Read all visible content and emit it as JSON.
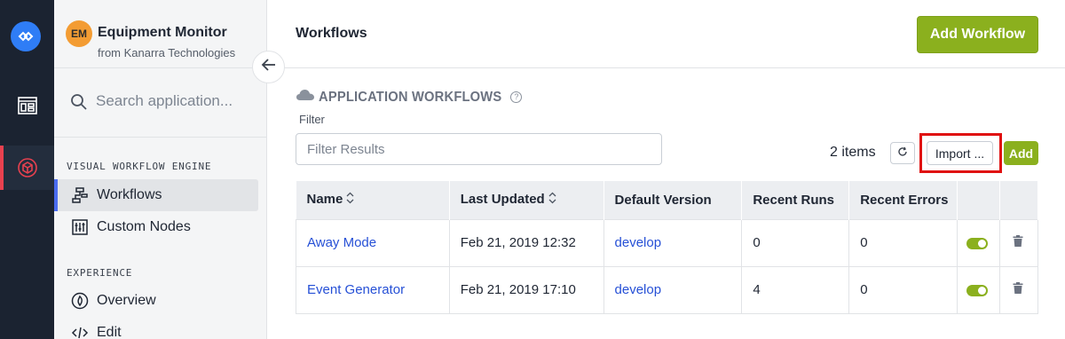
{
  "app": {
    "avatar_initials": "EM",
    "name": "Equipment Monitor",
    "org": "from Kanarra Technologies",
    "avatar_color": "#f39c33"
  },
  "search": {
    "placeholder": "Search application..."
  },
  "sidebar": {
    "sections": [
      {
        "label": "VISUAL WORKFLOW ENGINE"
      },
      {
        "label": "EXPERIENCE"
      }
    ],
    "items": [
      {
        "label": "Workflows",
        "icon": "workflow-icon",
        "active": true
      },
      {
        "label": "Custom Nodes",
        "icon": "sliders-icon",
        "active": false
      },
      {
        "label": "Overview",
        "icon": "flame-icon",
        "active": false
      },
      {
        "label": "Edit",
        "icon": "code-icon",
        "active": false
      }
    ]
  },
  "header": {
    "title": "Workflows",
    "add_workflow_label": "Add Workflow"
  },
  "section": {
    "title": "APPLICATION WORKFLOWS",
    "filter_label": "Filter",
    "filter_placeholder": "Filter Results",
    "item_count": "2 items",
    "import_label": "Import ...",
    "add_label": "Add"
  },
  "table": {
    "columns": [
      "Name",
      "Last Updated",
      "Default Version",
      "Recent Runs",
      "Recent Errors"
    ],
    "rows": [
      {
        "name": "Away Mode",
        "last_updated": "Feb 21, 2019 12:32",
        "version": "develop",
        "runs": "0",
        "errors": "0",
        "enabled": true
      },
      {
        "name": "Event Generator",
        "last_updated": "Feb 21, 2019 17:10",
        "version": "develop",
        "runs": "4",
        "errors": "0",
        "enabled": true
      }
    ]
  },
  "colors": {
    "rail_bg": "#1b2331",
    "accent_green": "#8bb01e",
    "link_blue": "#2650d6",
    "active_marker_red": "#e8414f",
    "highlight_red": "#e01010"
  }
}
